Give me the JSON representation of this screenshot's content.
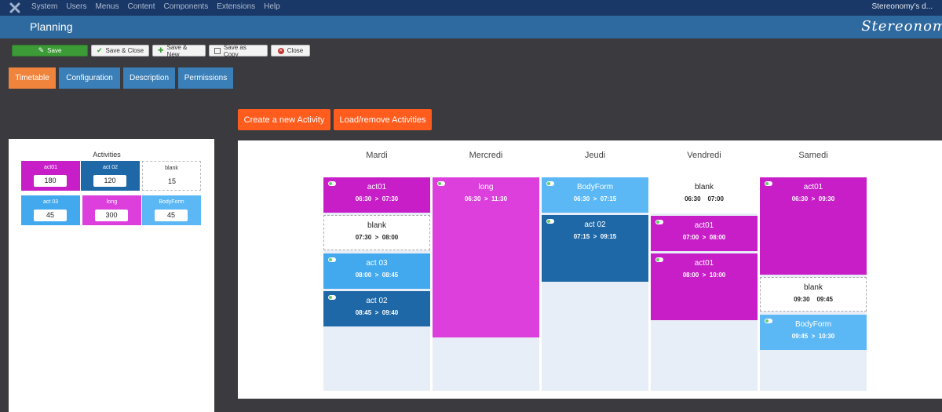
{
  "topbar": {
    "menu": [
      "System",
      "Users",
      "Menus",
      "Content",
      "Components",
      "Extensions",
      "Help"
    ],
    "site": "Stereonomy's d..."
  },
  "header": {
    "title": "Planning",
    "brand": "Stereonom"
  },
  "toolbar": {
    "save": "Save",
    "save_close": "Save & Close",
    "save_new": "Save & New",
    "save_copy": "Save as Copy",
    "close": "Close"
  },
  "tabs": [
    "Timetable",
    "Configuration",
    "Description",
    "Permissions"
  ],
  "actions": {
    "create": "Create a new Activity",
    "load": "Load/remove Activities"
  },
  "activities": {
    "title": "Activities",
    "items": [
      {
        "name": "act01",
        "value": "180",
        "color": "#c81ec8"
      },
      {
        "name": "act 02",
        "value": "120",
        "color": "#1f68a8"
      },
      {
        "name": "blank",
        "value": "15",
        "color": "#ffffff"
      },
      {
        "name": "act 03",
        "value": "45",
        "color": "#42a9ef"
      },
      {
        "name": "long",
        "value": "300",
        "color": "#dc3fdc"
      },
      {
        "name": "BodyForm",
        "value": "45",
        "color": "#5bb8f5"
      }
    ]
  },
  "timetable": {
    "days": [
      "Mardi",
      "Mercredi",
      "Jeudi",
      "Vendredi",
      "Samedi"
    ],
    "mardi": [
      {
        "name": "act01",
        "start": "06:30",
        "sep": ">",
        "end": "07:30"
      },
      {
        "name": "blank",
        "start": "07:30",
        "sep": ">",
        "end": "08:00"
      },
      {
        "name": "act 03",
        "start": "08:00",
        "sep": ">",
        "end": "08:45"
      },
      {
        "name": "act 02",
        "start": "08:45",
        "sep": ">",
        "end": "09:40"
      }
    ],
    "mercredi": [
      {
        "name": "long",
        "start": "06:30",
        "sep": ">",
        "end": "11:30"
      }
    ],
    "jeudi": [
      {
        "name": "BodyForm",
        "start": "06:30",
        "sep": ">",
        "end": "07:15"
      },
      {
        "name": "act 02",
        "start": "07:15",
        "sep": ">",
        "end": "09:15"
      }
    ],
    "vendredi": [
      {
        "name": "blank",
        "start": "06:30",
        "sep": "",
        "end": "07:00"
      },
      {
        "name": "act01",
        "start": "07:00",
        "sep": ">",
        "end": "08:00"
      },
      {
        "name": "act01",
        "start": "08:00",
        "sep": ">",
        "end": "10:00"
      }
    ],
    "samedi": [
      {
        "name": "act01",
        "start": "06:30",
        "sep": ">",
        "end": "09:30"
      },
      {
        "name": "blank",
        "start": "09:30",
        "sep": "",
        "end": "09:45"
      },
      {
        "name": "BodyForm",
        "start": "09:45",
        "sep": ">",
        "end": "10:30"
      }
    ]
  }
}
